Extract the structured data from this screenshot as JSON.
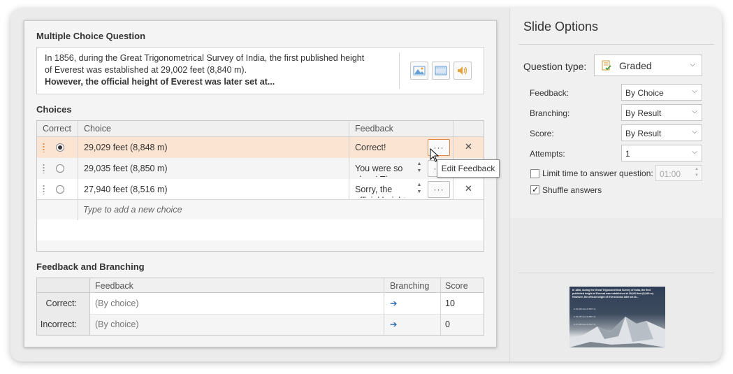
{
  "editor": {
    "question_title": "Multiple Choice Question",
    "question_line1": "In 1856, during the Great Trigonometrical Survey of India, the first published height",
    "question_line2": "of Everest was established at 29,002 feet (8,840 m).",
    "question_line3": "However, the official height of Everest was later set at...",
    "choices_title": "Choices",
    "choices_headers": {
      "correct": "Correct",
      "choice": "Choice",
      "feedback": "Feedback"
    },
    "choices": [
      {
        "text": "29,029 feet (8,848 m)",
        "feedback": "Correct!",
        "more": "···",
        "delete": "✕",
        "selected": true
      },
      {
        "text": "29,035 feet (8,850 m)",
        "feedback": "You were so close! The official",
        "more": "···",
        "delete": "",
        "selected": false
      },
      {
        "text": "27,940 feet (8,516 m)",
        "feedback": "Sorry, the official height is",
        "more": "···",
        "delete": "✕",
        "selected": false
      }
    ],
    "add_choice_placeholder": "Type to add a new choice",
    "tooltip": "Edit Feedback",
    "fb_title": "Feedback and Branching",
    "fb_headers": {
      "feedback": "Feedback",
      "branching": "Branching",
      "score": "Score"
    },
    "fb_rows": [
      {
        "label": "Correct:",
        "feedback": "(By choice)",
        "branch": "➔",
        "score": "10"
      },
      {
        "label": "Incorrect:",
        "feedback": "(By choice)",
        "branch": "➔",
        "score": "0"
      }
    ]
  },
  "options": {
    "title": "Slide Options",
    "question_type_label": "Question type:",
    "question_type_value": "Graded",
    "feedback_label": "Feedback:",
    "feedback_value": "By Choice",
    "branching_label": "Branching:",
    "branching_value": "By Result",
    "score_label": "Score:",
    "score_value": "By Result",
    "attempts_label": "Attempts:",
    "attempts_value": "1",
    "limit_time_label": "Limit time to answer question:",
    "limit_time_value": "01:00",
    "limit_time_checked": false,
    "shuffle_label": "Shuffle answers",
    "shuffle_checked": true
  },
  "thumbnail": {
    "text": "In 1856, during the Great Trigonometrical Survey of India, the first published height of Everest was established at 29,002 feet (8,840 m). However, the official height of Everest was later set at...",
    "choices": [
      "29,029 feet (8,848 m)",
      "29,035 feet (8,850 m)",
      "27,940 feet (8,516 m)"
    ]
  },
  "colors": {
    "selected_row": "#fce4d2",
    "accent_orange": "#e0874a",
    "link_blue": "#2d6db5"
  }
}
